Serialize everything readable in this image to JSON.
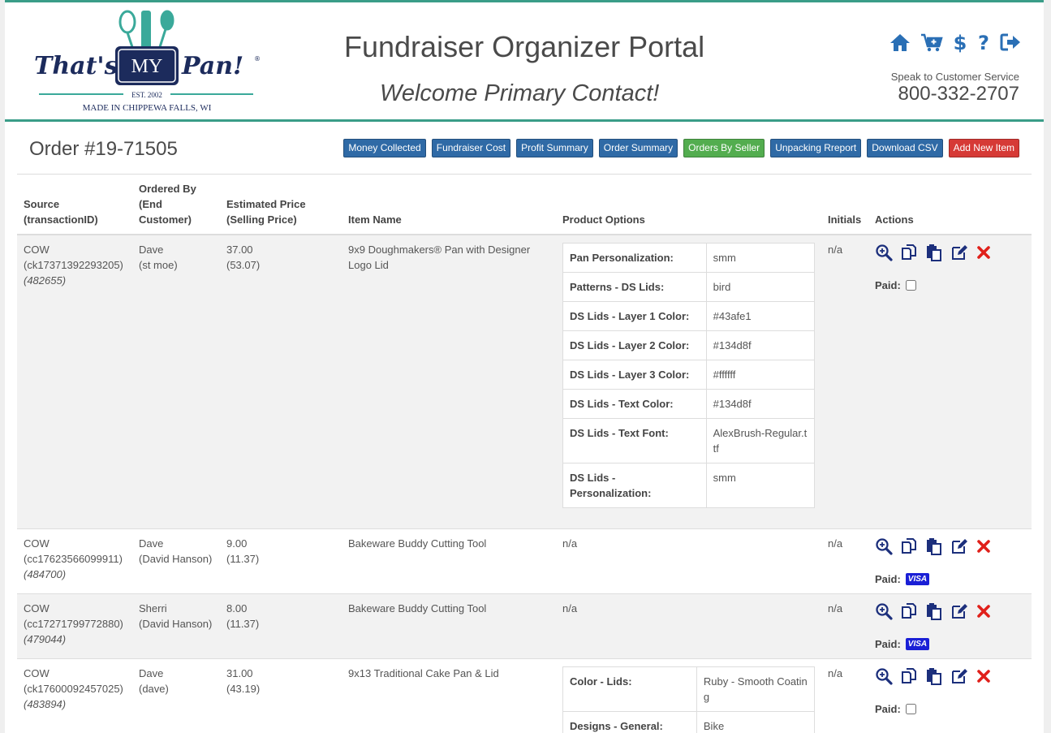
{
  "brand": {
    "logo_text": "That's MY Pan!",
    "logo_est": "EST. 2002",
    "logo_tagline": "MADE IN CHIPPEWA FALLS, WI"
  },
  "header": {
    "title": "Fundraiser Organizer Portal",
    "welcome": "Welcome Primary Contact!",
    "cs_label": "Speak to Customer Service",
    "cs_phone": "800-332-2707",
    "icons": [
      "home-icon",
      "cart-add-icon",
      "dollar-icon",
      "help-icon",
      "logout-icon"
    ]
  },
  "order": {
    "title": "Order #19-71505"
  },
  "buttons": {
    "money_collected": "Money Collected",
    "fundraiser_cost": "Fundraiser Cost",
    "profit_summary": "Profit Summary",
    "order_summary": "Order Summary",
    "orders_by_seller": "Orders By Seller",
    "unpacking_report": "Unpacking Rreport",
    "download_csv": "Download CSV",
    "add_new_item": "Add New Item"
  },
  "columns": {
    "source": "Source (transactionID)",
    "ordered_by": "Ordered By (End Customer)",
    "price": "Estimated Price (Selling Price)",
    "item": "Item Name",
    "options": "Product Options",
    "initials": "Initials",
    "actions": "Actions"
  },
  "paid_label": "Paid:",
  "visa_label": "VISA",
  "colors": {
    "accent": "#3a9d88",
    "button_blue": "#2f6aa6",
    "button_green": "#53ad4f",
    "button_red": "#d63a36",
    "icon_blue": "#1c2f7c",
    "delete_red": "#e0201a"
  },
  "rows": [
    {
      "source": "COW",
      "txn": "(ck17371392293205)",
      "id": "(482655)",
      "seller": "Dave",
      "customer": "(st moe)",
      "price": "37.00",
      "selling": "(53.07)",
      "item": "9x9 Doughmakers® Pan with Designer Logo Lid",
      "initials": "n/a",
      "options": [
        {
          "k": "Pan Personalization:",
          "v": "smm"
        },
        {
          "k": "Patterns - DS Lids:",
          "v": "bird"
        },
        {
          "k": "DS Lids - Layer 1 Color:",
          "v": "#43afe1"
        },
        {
          "k": "DS Lids - Layer 2 Color:",
          "v": "#134d8f"
        },
        {
          "k": "DS Lids - Layer 3 Color:",
          "v": "#ffffff"
        },
        {
          "k": "DS Lids - Text Color:",
          "v": "#134d8f"
        },
        {
          "k": "DS Lids - Text Font:",
          "v": "AlexBrush-Regular.ttf"
        },
        {
          "k": "DS Lids - Personalization:",
          "v": "smm"
        }
      ]
    },
    {
      "source": "COW",
      "txn": "(cc17623566099911)",
      "id": "(484700)",
      "seller": "Dave",
      "customer": "(David Hanson)",
      "price": "9.00",
      "selling": "(11.37)",
      "item": "Bakeware Buddy Cutting Tool",
      "options_text": "n/a",
      "initials": "n/a"
    },
    {
      "source": "COW",
      "txn": "(cc17271799772880)",
      "id": "(479044)",
      "seller": "Sherri",
      "customer": "(David Hanson)",
      "price": "8.00",
      "selling": "(11.37)",
      "item": "Bakeware Buddy Cutting Tool",
      "options_text": "n/a",
      "initials": "n/a"
    },
    {
      "source": "COW",
      "txn": "(ck17600092457025)",
      "id": "(483894)",
      "seller": "Dave",
      "customer": "(dave)",
      "price": "31.00",
      "selling": "(43.19)",
      "item": "9x13 Traditional Cake Pan & Lid",
      "initials": "n/a",
      "options": [
        {
          "k": "Color - Lids:",
          "v": "Ruby - Smooth Coating"
        },
        {
          "k": "Designs - General:",
          "v": "Bike"
        }
      ]
    }
  ]
}
